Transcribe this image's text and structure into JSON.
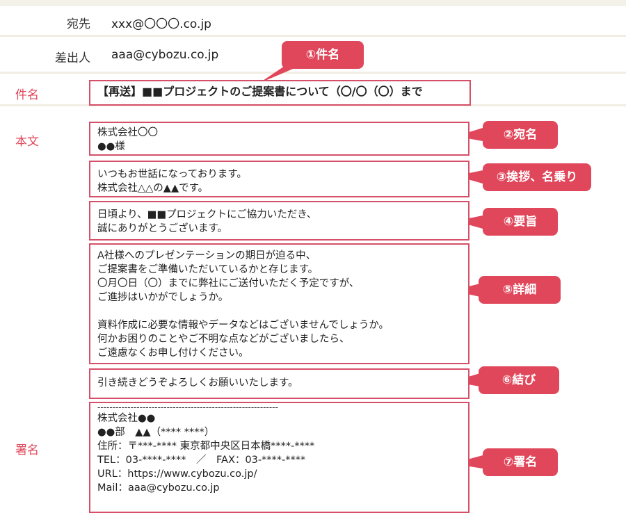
{
  "header": {
    "to_label": "宛先",
    "to_value": "xxx@〇〇〇.co.jp",
    "from_label": "差出人",
    "from_value": "aaa@cybozu.co.jp"
  },
  "side_labels": {
    "subject": "件名",
    "body": "本文",
    "signature": "署名"
  },
  "subject": "【再送】■■プロジェクトのご提案書について（〇/〇（〇）まで",
  "addressee": [
    "株式会社〇〇",
    "●●様"
  ],
  "greeting": [
    "いつもお世話になっております。",
    "株式会社△△の▲▲です。"
  ],
  "summary": [
    "日頃より、■■プロジェクトにご協力いただき、",
    "誠にありがとうございます。"
  ],
  "details": [
    "A社様へのプレゼンテーションの期日が迫る中、",
    "ご提案書をご準備いただいているかと存じます。",
    "〇月〇日（〇）までに弊社にご送付いただく予定ですが、",
    "ご進捗はいかがでしょうか。",
    "",
    "資料作成に必要な情報やデータなどはございませんでしょうか。",
    "何かお困りのことやご不明な点などがございましたら、",
    "ご遠慮なくお申し付けください。"
  ],
  "closing": [
    "引き続きどうぞよろしくお願いいたします。"
  ],
  "signature": [
    "------------------------------------------------------------",
    "株式会社●●",
    "●●部　▲▲（**** ****）",
    "住所：〒***-**** 東京都中央区日本橋****-****",
    "TEL：03-****-****　／　FAX：03-****-****",
    "URL：https://www.cybozu.co.jp/",
    "Mail：aaa@cybozu.co.jp"
  ],
  "callouts": {
    "subject": "①件名",
    "addressee": "②宛名",
    "greeting": "③挨拶、名乗り",
    "summary": "④要旨",
    "details": "⑤詳細",
    "closing": "⑥結び",
    "signature": "⑦署名"
  },
  "colors": {
    "accent": "#e0475b",
    "box_border": "#d64f68",
    "label": "#e0485a"
  }
}
